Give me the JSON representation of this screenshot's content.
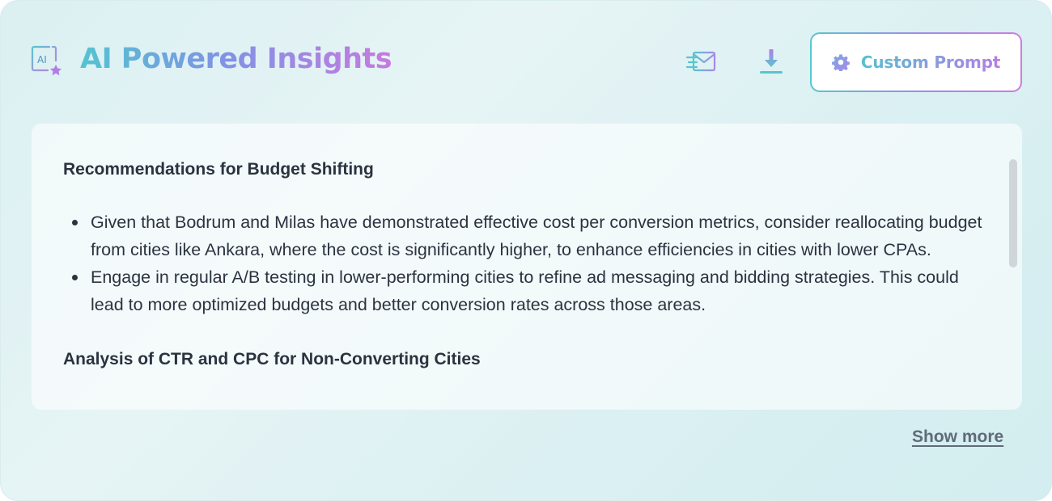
{
  "header": {
    "title": "AI Powered Insights",
    "ai_icon_text": "AI",
    "actions": {
      "email_icon": "mail-icon",
      "download_icon": "download-icon",
      "custom_prompt_label": "Custom Prompt",
      "custom_prompt_icon": "gear-icon"
    }
  },
  "insights": {
    "sections": [
      {
        "heading": "Recommendations for Budget Shifting",
        "bullets": [
          "Given that Bodrum and Milas have demonstrated effective cost per conversion metrics, consider reallocating budget from cities like Ankara, where the cost is significantly higher, to enhance efficiencies in cities with lower CPAs.",
          "Engage in regular A/B testing in lower-performing cities to refine ad messaging and bidding strategies. This could lead to more optimized budgets and better conversion rates across those areas."
        ]
      },
      {
        "heading": "Analysis of CTR and CPC for Non-Converting Cities"
      }
    ]
  },
  "footer": {
    "show_more_label": "Show more"
  },
  "colors": {
    "gradient_start": "#54c4d0",
    "gradient_mid": "#7f93e6",
    "gradient_end": "#c77ae0",
    "text": "#2b3340",
    "link": "#5f6b78"
  }
}
